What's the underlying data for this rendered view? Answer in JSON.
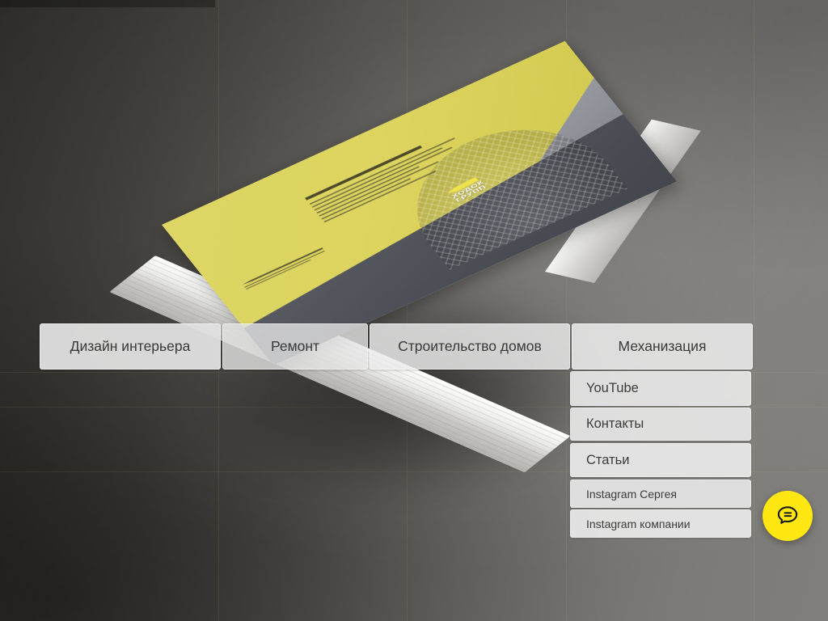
{
  "nav": {
    "items": [
      {
        "id": "interior",
        "label": "Дизайн интерьера"
      },
      {
        "id": "repair",
        "label": "Ремонт"
      },
      {
        "id": "houses",
        "label": "Строительство домов"
      },
      {
        "id": "mech",
        "label": "Механизация"
      }
    ]
  },
  "dropdown": {
    "items": [
      {
        "id": "youtube",
        "label": "YouTube"
      },
      {
        "id": "contacts",
        "label": "Контакты"
      },
      {
        "id": "articles",
        "label": "Статьи"
      },
      {
        "id": "insta_s",
        "label": "Instagram Сергея"
      },
      {
        "id": "insta_c",
        "label": "Instagram компании"
      }
    ]
  },
  "hero": {
    "brochure": {
      "logo_line1": "ХОДОК",
      "logo_line2": "ГРУПП"
    }
  },
  "chat": {
    "icon": "chat-bubble-icon",
    "label": "",
    "color": "#ffe812"
  },
  "colors": {
    "accent_yellow": "#ffe812",
    "cover_yellow": "#ded665",
    "nav_surface": "#e9e9e9",
    "background_dark": "#2c2b29",
    "background_light": "#807e7a",
    "text": "#3a3a3a"
  }
}
